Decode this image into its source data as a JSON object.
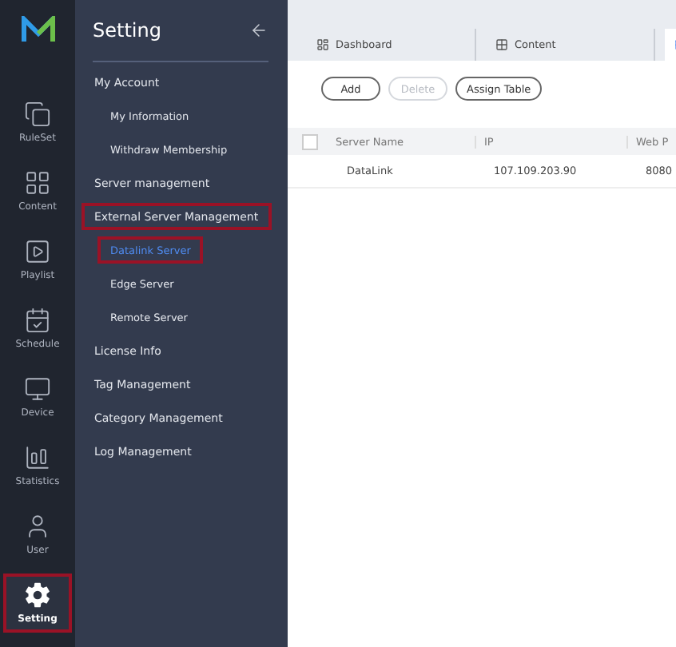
{
  "rail": [
    {
      "label": "RuleSet",
      "selected": false,
      "highlighted": false
    },
    {
      "label": "Content",
      "selected": false,
      "highlighted": false
    },
    {
      "label": "Playlist",
      "selected": false,
      "highlighted": false
    },
    {
      "label": "Schedule",
      "selected": false,
      "highlighted": false
    },
    {
      "label": "Device",
      "selected": false,
      "highlighted": false
    },
    {
      "label": "Statistics",
      "selected": false,
      "highlighted": false
    },
    {
      "label": "User",
      "selected": false,
      "highlighted": false
    },
    {
      "label": "Setting",
      "selected": true,
      "highlighted": true
    }
  ],
  "menu": {
    "title": "Setting",
    "items": [
      {
        "label": "My Account",
        "kind": "group",
        "selected": false,
        "highlighted": false
      },
      {
        "label": "My Information",
        "kind": "sub",
        "selected": false,
        "highlighted": false
      },
      {
        "label": "Withdraw Membership",
        "kind": "sub",
        "selected": false,
        "highlighted": false
      },
      {
        "label": "Server management",
        "kind": "group",
        "selected": false,
        "highlighted": false
      },
      {
        "label": "External Server Management",
        "kind": "group",
        "selected": false,
        "highlighted": true
      },
      {
        "label": "Datalink Server",
        "kind": "sub",
        "selected": true,
        "highlighted": true
      },
      {
        "label": "Edge Server",
        "kind": "sub",
        "selected": false,
        "highlighted": false
      },
      {
        "label": "Remote Server",
        "kind": "sub",
        "selected": false,
        "highlighted": false
      },
      {
        "label": "License Info",
        "kind": "group",
        "selected": false,
        "highlighted": false
      },
      {
        "label": "Tag Management",
        "kind": "group",
        "selected": false,
        "highlighted": false
      },
      {
        "label": "Category Management",
        "kind": "group",
        "selected": false,
        "highlighted": false
      },
      {
        "label": "Log Management",
        "kind": "group",
        "selected": false,
        "highlighted": false
      }
    ]
  },
  "tabs": [
    {
      "label": "Dashboard",
      "selected": false
    },
    {
      "label": "Content",
      "selected": false
    },
    {
      "selected": true
    }
  ],
  "buttons": [
    {
      "label": "Add",
      "disabled": false
    },
    {
      "label": "Delete",
      "disabled": true
    },
    {
      "label": "Assign Table",
      "disabled": false
    }
  ],
  "table": {
    "columns": [
      "Server Name",
      "IP",
      "Web P"
    ],
    "header_checked": false,
    "rows": [
      {
        "cells": [
          "DataLink",
          "107.109.203.90",
          "8080"
        ]
      }
    ]
  }
}
